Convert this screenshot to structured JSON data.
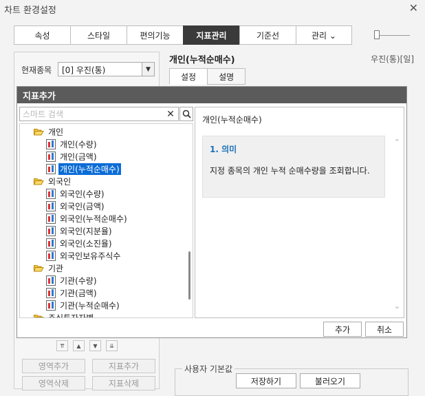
{
  "window": {
    "title": "차트 환경설정"
  },
  "tabs": [
    {
      "label": "속성",
      "width": 82
    },
    {
      "label": "스타일",
      "width": 82
    },
    {
      "label": "편의기능",
      "width": 82
    },
    {
      "label": "지표관리",
      "width": 82,
      "active": true
    },
    {
      "label": "기준선",
      "width": 82
    },
    {
      "label": "관리 ⌄",
      "width": 82
    }
  ],
  "left": {
    "stock_label": "현재종목",
    "stock_value": "[0] 우진(통)"
  },
  "right": {
    "title": "개인(누적순매수)",
    "stock": "우진(통)[일]",
    "subtabs": [
      "설정",
      "설명"
    ]
  },
  "modal": {
    "title": "지표추가",
    "search_placeholder": "스마트 검색",
    "tree": [
      {
        "type": "folder",
        "label": "개인"
      },
      {
        "type": "item",
        "label": "개인(수량)"
      },
      {
        "type": "item",
        "label": "개인(금액)"
      },
      {
        "type": "item",
        "label": "개인(누적순매수)",
        "selected": true
      },
      {
        "type": "folder",
        "label": "외국인"
      },
      {
        "type": "item",
        "label": "외국인(수량)"
      },
      {
        "type": "item",
        "label": "외국인(금액)"
      },
      {
        "type": "item",
        "label": "외국인(누적순매수)"
      },
      {
        "type": "item",
        "label": "외국인(지분율)"
      },
      {
        "type": "item",
        "label": "외국인(소진율)"
      },
      {
        "type": "item",
        "label": "외국인보유주식수"
      },
      {
        "type": "folder",
        "label": "기관"
      },
      {
        "type": "item",
        "label": "기관(수량)"
      },
      {
        "type": "item",
        "label": "기관(금액)"
      },
      {
        "type": "item",
        "label": "기관(누적순매수)"
      },
      {
        "type": "folder",
        "label": "주식투자자별"
      }
    ],
    "desc": {
      "name": "개인(누적순매수)",
      "heading": "1. 의미",
      "body": "지정 종목의 개인 누적 순매수량을 조회합니다."
    },
    "add_button": "추가",
    "cancel_button": "취소"
  },
  "bottom": {
    "area_add": "영역추가",
    "indicator_add": "지표추가",
    "area_delete": "영역삭제",
    "indicator_delete": "지표삭제",
    "defaults_legend": "사용자 기본값",
    "save": "저장하기",
    "load": "불러오기"
  },
  "colors": {
    "active_tab": "#3a3a3a",
    "selection": "#0a6cd6",
    "heading": "#1a6fb8"
  }
}
